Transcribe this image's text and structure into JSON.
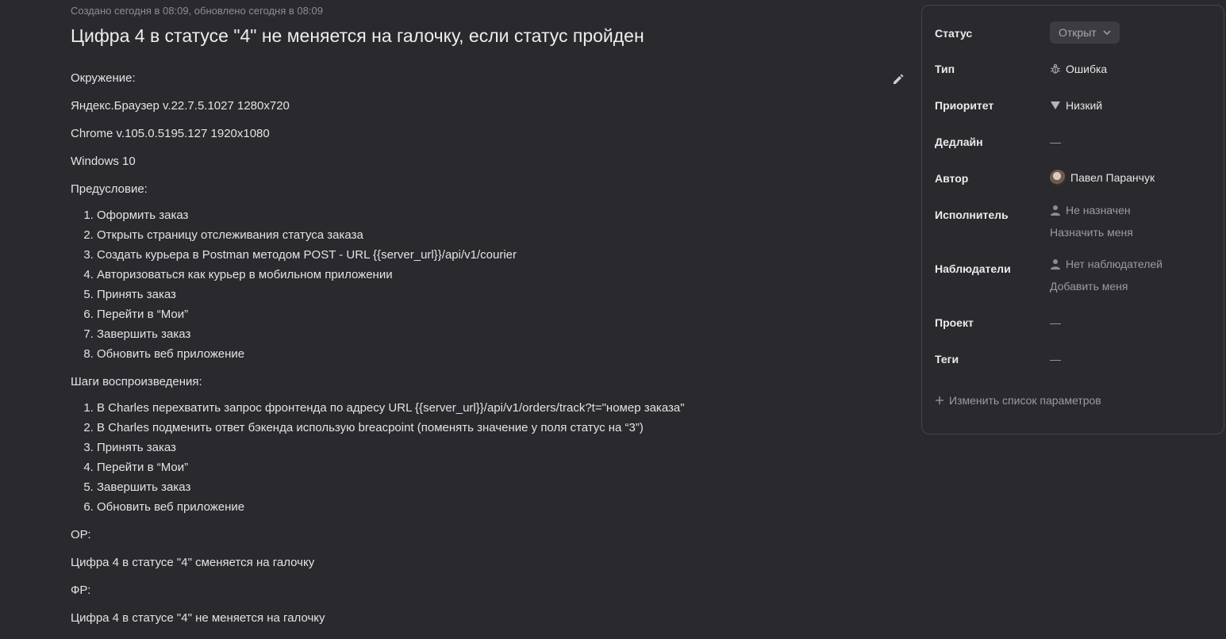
{
  "issue": {
    "meta": "Создано сегодня в 08:09, обновлено сегодня в 08:09",
    "title": "Цифра 4 в статусе \"4\" не меняется на галочку, если статус пройден"
  },
  "description": {
    "env_heading": "Окружение:",
    "env": [
      "Яндекс.Браузер v.22.7.5.1027 1280x720",
      "Chrome v.105.0.5195.127 1920x1080",
      "Windows 10"
    ],
    "pre_heading": "Предусловие:",
    "pre_steps": [
      "Оформить заказ",
      "Открыть страницу отслеживания статуса заказа",
      "Создать курьера в Postman методом POST - URL {{server_url}}/api/v1/courier",
      "Авторизоваться как курьер в мобильном приложении",
      "Принять заказ",
      "Перейти в “Мои”",
      "Завершить заказ",
      "Обновить веб приложение"
    ],
    "repro_heading": "Шаги воспроизведения:",
    "repro_steps": [
      "В Charles перехватить запрос фронтенда по адресу URL {{server_url}}/api/v1/orders/track?t=\"номер заказа\"",
      "В Charles подменить ответ бэкенда использую breacpoint (поменять значение у поля статус на “3”)",
      "Принять заказ",
      "Перейти в “Мои”",
      "Завершить заказ",
      "Обновить веб приложение"
    ],
    "expected_heading": "ОР:",
    "expected": "Цифра 4 в статусе \"4\" сменяется на галочку",
    "actual_heading": "ФР:",
    "actual": "Цифра 4 в статусе \"4\" не меняется на галочку"
  },
  "sidebar": {
    "status_label": "Статус",
    "status_value": "Открыт",
    "type_label": "Тип",
    "type_value": "Ошибка",
    "priority_label": "Приоритет",
    "priority_value": "Низкий",
    "deadline_label": "Дедлайн",
    "deadline_value": "—",
    "author_label": "Автор",
    "author_value": "Павел Паранчук",
    "assignee_label": "Исполнитель",
    "assignee_value": "Не назначен",
    "assign_me": "Назначить меня",
    "watchers_label": "Наблюдатели",
    "watchers_value": "Нет наблюдателей",
    "add_me": "Добавить меня",
    "project_label": "Проект",
    "project_value": "—",
    "tags_label": "Теги",
    "tags_value": "—",
    "change_params": "Изменить список параметров"
  },
  "colors": {
    "background": "#2a292e",
    "panel_border": "#45444a",
    "muted_text": "#9c9ba0"
  },
  "icons": {
    "edit": "pencil-icon",
    "status_dropdown": "chevron-down-icon",
    "type": "bug-icon",
    "priority": "triangle-down-icon",
    "author": "avatar",
    "assignee": "user-icon",
    "watchers": "user-icon",
    "change_params": "plus-icon"
  }
}
